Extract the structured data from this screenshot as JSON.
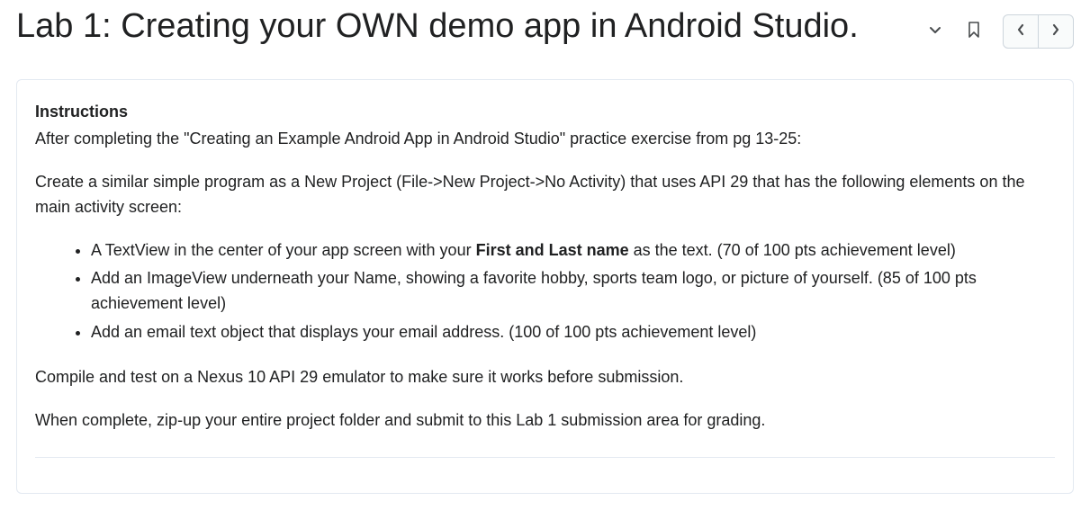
{
  "title": "Lab 1: Creating your OWN demo app in Android Studio.",
  "card": {
    "heading": "Instructions",
    "intro": "After completing the \"Creating an Example Android App in Android Studio\" practice exercise from pg 13-25:",
    "setup": "Create a similar simple program as a New Project (File->New Project->No Activity) that uses API 29 that has the following elements on the main activity screen:",
    "reqs": [
      {
        "pre": "A TextView in the center of your app screen with your ",
        "bold": "First and Last name",
        "post": " as the text.  (70 of 100 pts achievement level)"
      },
      {
        "pre": "Add an ImageView underneath your Name, showing a favorite hobby, sports team logo, or picture of yourself.  (85 of 100 pts achievement level)",
        "bold": "",
        "post": ""
      },
      {
        "pre": "Add an email text object that displays your email address. (100 of 100 pts achievement level)",
        "bold": "",
        "post": ""
      }
    ],
    "compile": "Compile and test on a Nexus 10 API 29 emulator to make sure it works before submission.",
    "submit": "When complete, zip-up your entire project folder and submit to this Lab 1 submission area for grading."
  }
}
